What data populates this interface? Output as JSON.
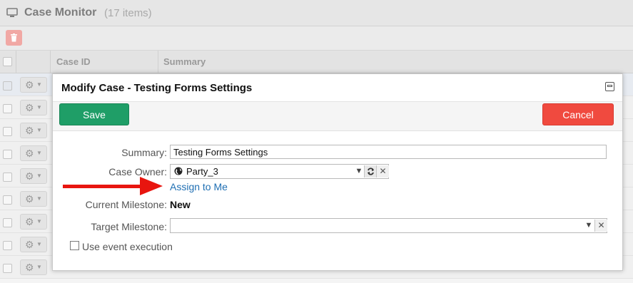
{
  "page": {
    "title": "Case Monitor",
    "count": "(17 items)"
  },
  "table": {
    "columns": [
      "Case ID",
      "Summary"
    ],
    "footer_text": "* ...  ..."
  },
  "modal": {
    "title": "Modify Case - Testing Forms Settings",
    "save_label": "Save",
    "cancel_label": "Cancel",
    "fields": {
      "summary_label": "Summary:",
      "summary_value": "Testing Forms Settings",
      "case_owner_label": "Case Owner:",
      "case_owner_value": "Party_3",
      "assign_link": "Assign to Me",
      "current_milestone_label": "Current Milestone:",
      "current_milestone_value": "New",
      "target_milestone_label": "Target Milestone:",
      "target_milestone_value": "",
      "event_execution_label": "Use event execution"
    }
  },
  "colors": {
    "save": "#1f9e67",
    "cancel": "#f04a3f",
    "link": "#1f6fb3",
    "arrow": "#e8150f"
  }
}
